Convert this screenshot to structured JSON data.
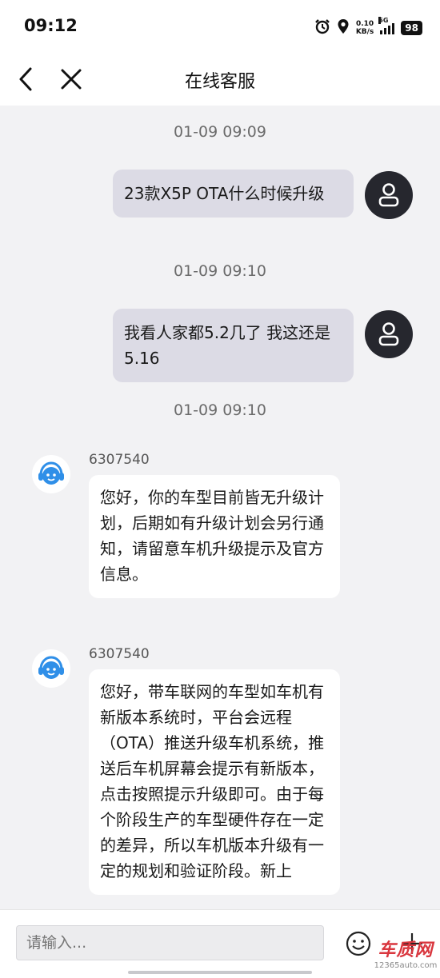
{
  "status_bar": {
    "time": "09:12",
    "speed_value": "0.10",
    "speed_unit": "KB/s",
    "network": "5G",
    "battery": "98"
  },
  "nav": {
    "title": "在线客服"
  },
  "messages": [
    {
      "type": "timestamp",
      "text": "01-09 09:09"
    },
    {
      "type": "user",
      "text": "23款X5P OTA什么时候升级"
    },
    {
      "type": "timestamp",
      "text": "01-09 09:10"
    },
    {
      "type": "user",
      "text": "我看人家都5.2几了 我这还是5.16"
    },
    {
      "type": "timestamp",
      "text": "01-09 09:10"
    },
    {
      "type": "agent",
      "name": "6307540",
      "text": "您好，你的车型目前皆无升级计划，后期如有升级计划会另行通知，请留意车机升级提示及官方信息。"
    },
    {
      "type": "agent",
      "name": "6307540",
      "text": "您好，带车联网的车型如车机有新版本系统时，平台会远程（OTA）推送升级车机系统，推送后车机屏幕会提示有新版本，点击按照提示升级即可。由于每个阶段生产的车型硬件存在一定的差异，所以车机版本升级有一定的规划和验证阶段。新上"
    }
  ],
  "input": {
    "placeholder": "请输入..."
  },
  "watermark": {
    "logo": "车质网",
    "url": "12365auto.com"
  },
  "icons": {
    "back": "chevron-left-icon",
    "close": "close-icon",
    "alarm": "alarm-clock-icon",
    "location": "location-pin-icon",
    "signal": "cellular-signal-icon",
    "user_avatar": "user-avatar-icon",
    "agent_avatar": "customer-service-headset-icon",
    "emoji": "emoji-icon",
    "more": "plus-icon"
  },
  "colors": {
    "user_bubble": "#dcdbe5",
    "agent_bubble": "#ffffff",
    "background": "#f2f2f4",
    "agent_icon": "#2f8fe8",
    "user_avatar": "#26272e"
  }
}
